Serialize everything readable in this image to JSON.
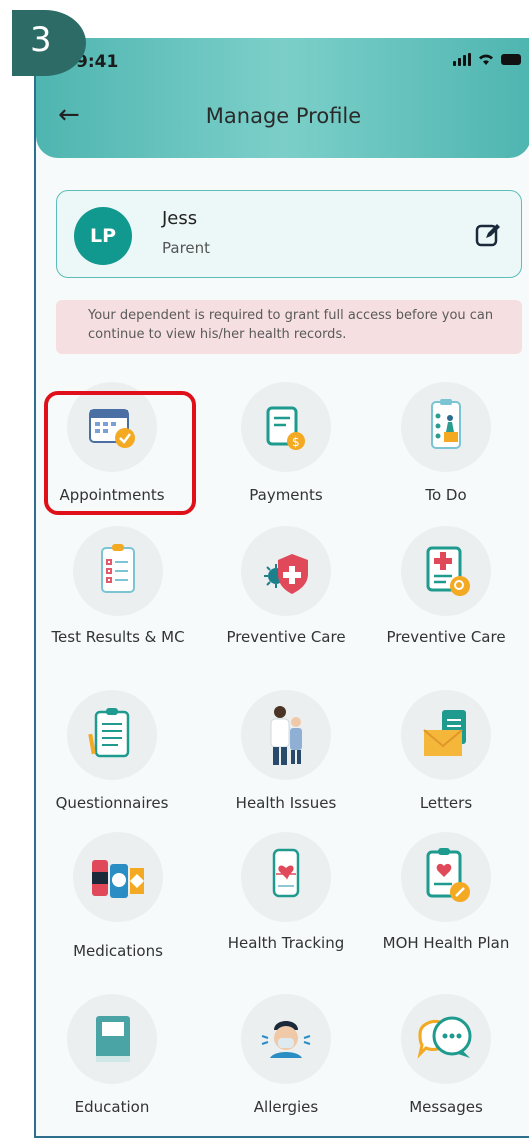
{
  "step_badge": "3",
  "status": {
    "time": "9:41"
  },
  "header": {
    "title": "Manage Profile"
  },
  "profile": {
    "initials": "LP",
    "name": "Jess",
    "role": "Parent"
  },
  "notice": "Your dependent is required to grant full access before you can continue to view his/her health records.",
  "menu": [
    {
      "label": "Appointments"
    },
    {
      "label": "Payments"
    },
    {
      "label": "To Do"
    },
    {
      "label": "Test Results & MC"
    },
    {
      "label": "Preventive Care"
    },
    {
      "label": "Preventive Care"
    },
    {
      "label": "Questionnaires"
    },
    {
      "label": "Health Issues"
    },
    {
      "label": "Letters"
    },
    {
      "label": "Medications"
    },
    {
      "label": "Health Tracking"
    },
    {
      "label": "MOH Health Plan"
    },
    {
      "label": "Education"
    },
    {
      "label": "Allergies"
    },
    {
      "label": "Messages"
    }
  ],
  "colors": {
    "accent": "#11988f",
    "header": "#4fb5b0",
    "highlight": "#e0101a",
    "badge": "#2d6b66"
  },
  "icons": [
    "back-arrow-icon",
    "edit-icon",
    "calendar-icon",
    "bill-icon",
    "clipboard-todo-icon",
    "test-results-icon",
    "virus-shield-icon",
    "medical-doc-icon",
    "questionnaire-icon",
    "doctor-icon",
    "envelope-icon",
    "medication-icon",
    "phone-heart-icon",
    "health-plan-icon",
    "book-icon",
    "allergy-icon",
    "chat-bubbles-icon"
  ]
}
